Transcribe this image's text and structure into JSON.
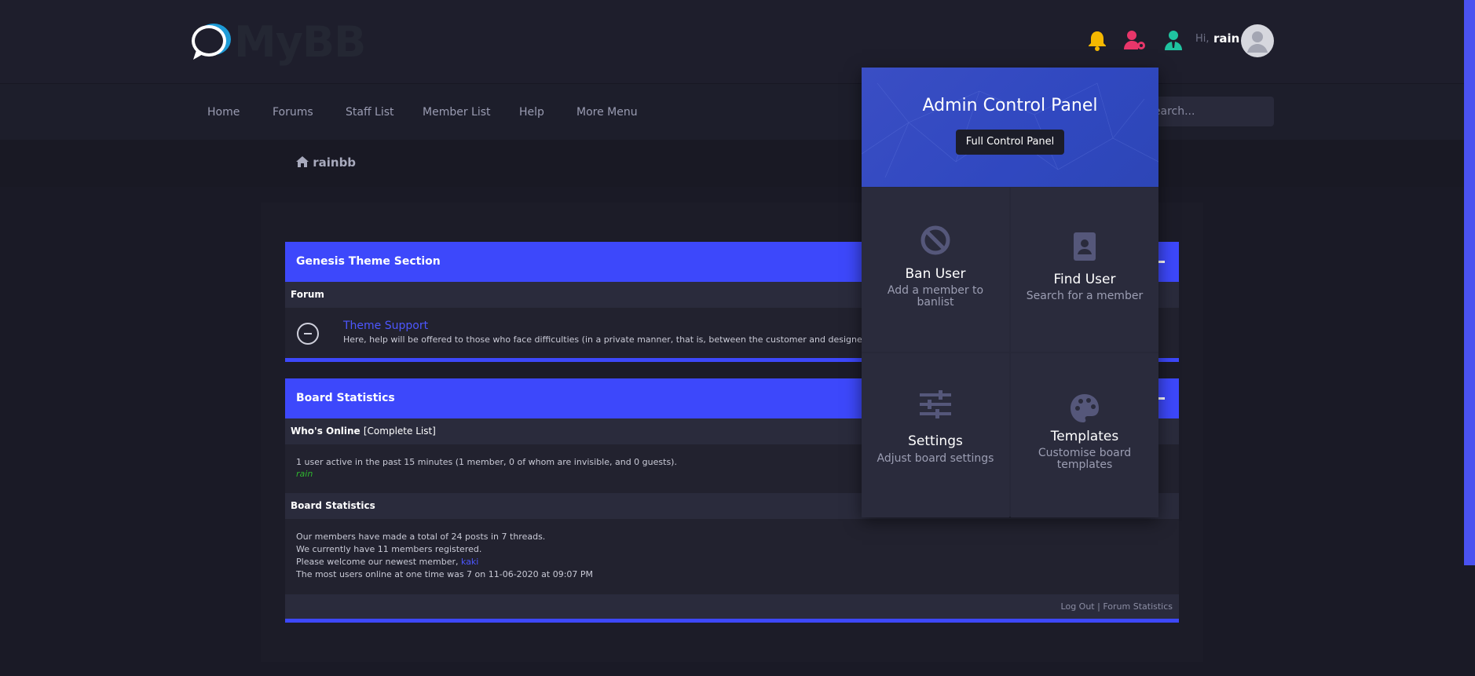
{
  "header": {
    "logo_text": "MyBB",
    "greeting": "Hi,",
    "username": "rain",
    "icons": [
      "bell-icon",
      "user-cog-icon",
      "user-tie-icon"
    ],
    "colors": {
      "bell": "#f5b800",
      "user_cog": "#e8366a",
      "user_tie": "#1fc3a0"
    }
  },
  "nav": {
    "items": [
      "Home",
      "Forums",
      "Staff List",
      "Member List",
      "Help",
      "More Menu"
    ],
    "search_placeholder": "Search..."
  },
  "breadcrumb": {
    "home": "rainbb"
  },
  "categories": [
    {
      "title": "Genesis Theme Section",
      "column_header": "Forum",
      "forums": [
        {
          "name": "Theme Support",
          "description": "Here, help will be offered to those who face difficulties (in a private manner, that is, between the customer and designer)"
        }
      ]
    }
  ],
  "board_stats": {
    "title": "Board Statistics",
    "whos_online_label": "Who's Online",
    "complete_list": "[Complete List]",
    "online_line": "1 user active in the past 15 minutes (1 member, 0 of whom are invisible, and 0 guests).",
    "online_user": "rain",
    "stats_header": "Board Statistics",
    "posts_line": "Our members have made a total of 24 posts in 7 threads.",
    "members_line": "We currently have 11 members registered.",
    "welcome_prefix": "Please welcome our newest member,",
    "newest_member": "kaki",
    "record_line": "The most users online at one time was 7 on 11-06-2020 at 09:07 PM"
  },
  "footer": {
    "logout": "Log Out",
    "separator": "|",
    "forum_stats": "Forum Statistics"
  },
  "admin_panel": {
    "title": "Admin Control Panel",
    "button": "Full Control Panel",
    "tiles": [
      {
        "title": "Ban User",
        "desc": "Add a member to banlist",
        "icon": "ban-icon"
      },
      {
        "title": "Find User",
        "desc": "Search for a member",
        "icon": "address-book-icon"
      },
      {
        "title": "Settings",
        "desc": "Adjust board settings",
        "icon": "sliders-icon"
      },
      {
        "title": "Templates",
        "desc": "Customise board templates",
        "icon": "palette-icon"
      }
    ]
  },
  "accent_color": "#3d48fb"
}
